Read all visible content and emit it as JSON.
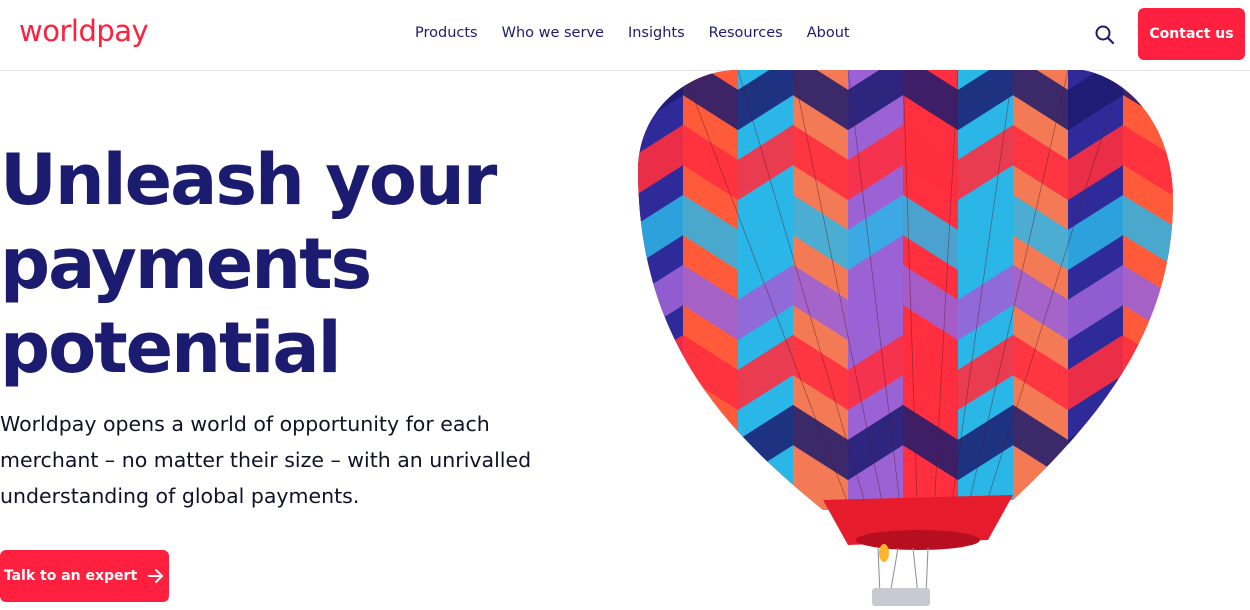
{
  "brand": {
    "name": "worldpay",
    "accent": "#ff1f3e",
    "navy": "#1b1b6f"
  },
  "nav": {
    "items": [
      {
        "label": "Products"
      },
      {
        "label": "Who we serve"
      },
      {
        "label": "Insights"
      },
      {
        "label": "Resources"
      },
      {
        "label": "About"
      }
    ],
    "search_icon": "search-icon"
  },
  "header": {
    "contact_label": "Contact us"
  },
  "hero": {
    "title_lines": [
      "Unleash your",
      "payments",
      "potential"
    ],
    "description": "Worldpay opens a world of opportunity for each merchant – no matter their size – with an unrivalled understanding of global payments.",
    "cta_label": "Talk to an expert",
    "cta_icon": "arrow-right-icon",
    "image": "hot-air-balloon-image"
  }
}
